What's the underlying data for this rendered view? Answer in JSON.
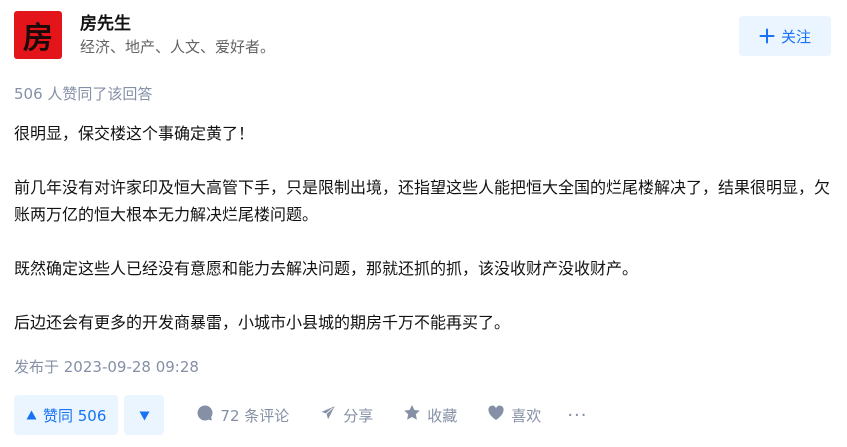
{
  "author": {
    "avatar_text": "房",
    "name": "房先生",
    "bio": "经济、地产、人文、爱好者。",
    "follow_label": "关注"
  },
  "vote_summary": "506 人赞同了该回答",
  "content": {
    "paragraphs": [
      "很明显，保交楼这个事确定黄了！",
      "前几年没有对许家印及恒大高管下手，只是限制出境，还指望这些人能把恒大全国的烂尾楼解决了，结果很明显，欠账两万亿的恒大根本无力解决烂尾楼问题。",
      "既然确定这些人已经没有意愿和能力去解决问题，那就还抓的抓，该没收财产没收财产。",
      "后边还会有更多的开发商暴雷，小城市小县城的期房千万不能再买了。"
    ]
  },
  "publish_time": "发布于 2023-09-28 09:28",
  "actions": {
    "upvote_label": "赞同 506",
    "comments_label": "72 条评论",
    "share_label": "分享",
    "favorite_label": "收藏",
    "like_label": "喜欢",
    "more_label": "···"
  },
  "colors": {
    "accent": "#1772f6",
    "accent_bg": "#ebf5ff",
    "muted": "#8590a6",
    "avatar_bg": "#e4141b"
  },
  "icons": [
    "plus-icon",
    "upvote-triangle-icon",
    "downvote-triangle-icon",
    "comment-icon",
    "share-icon",
    "star-icon",
    "heart-icon",
    "more-icon"
  ]
}
